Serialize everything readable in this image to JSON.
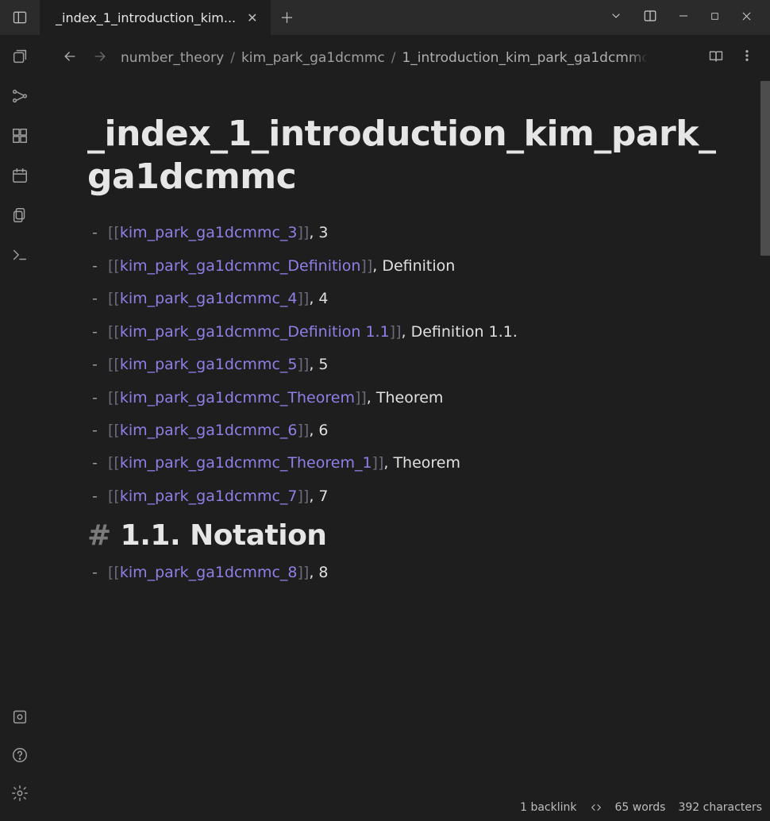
{
  "tab": {
    "label": "_index_1_introduction_kim..."
  },
  "breadcrumbs": {
    "seg0": "number_theory",
    "seg1": "kim_park_ga1dcmmc",
    "seg2": "1_introduction_kim_park_ga1dcmmc"
  },
  "doc": {
    "title": "_index_1_introduction_kim_park_ga1dcmmc",
    "list1": [
      {
        "link": "kim_park_ga1dcmmc_3",
        "suffix": ", 3"
      },
      {
        "link": "kim_park_ga1dcmmc_Definition",
        "suffix": ", Definition"
      },
      {
        "link": "kim_park_ga1dcmmc_4",
        "suffix": ", 4"
      },
      {
        "link": "kim_park_ga1dcmmc_Definition 1.1",
        "suffix": ", Definition 1.1."
      },
      {
        "link": "kim_park_ga1dcmmc_5",
        "suffix": ", 5"
      },
      {
        "link": "kim_park_ga1dcmmc_Theorem",
        "suffix": ", Theorem"
      },
      {
        "link": "kim_park_ga1dcmmc_6",
        "suffix": ", 6"
      },
      {
        "link": "kim_park_ga1dcmmc_Theorem_1",
        "suffix": ", Theorem"
      },
      {
        "link": "kim_park_ga1dcmmc_7",
        "suffix": ", 7"
      }
    ],
    "h2": "1.1. Notation",
    "list2": [
      {
        "link": "kim_park_ga1dcmmc_8",
        "suffix": ", 8"
      }
    ]
  },
  "status": {
    "backlinks": "1 backlink",
    "words": "65 words",
    "chars": "392 characters"
  }
}
